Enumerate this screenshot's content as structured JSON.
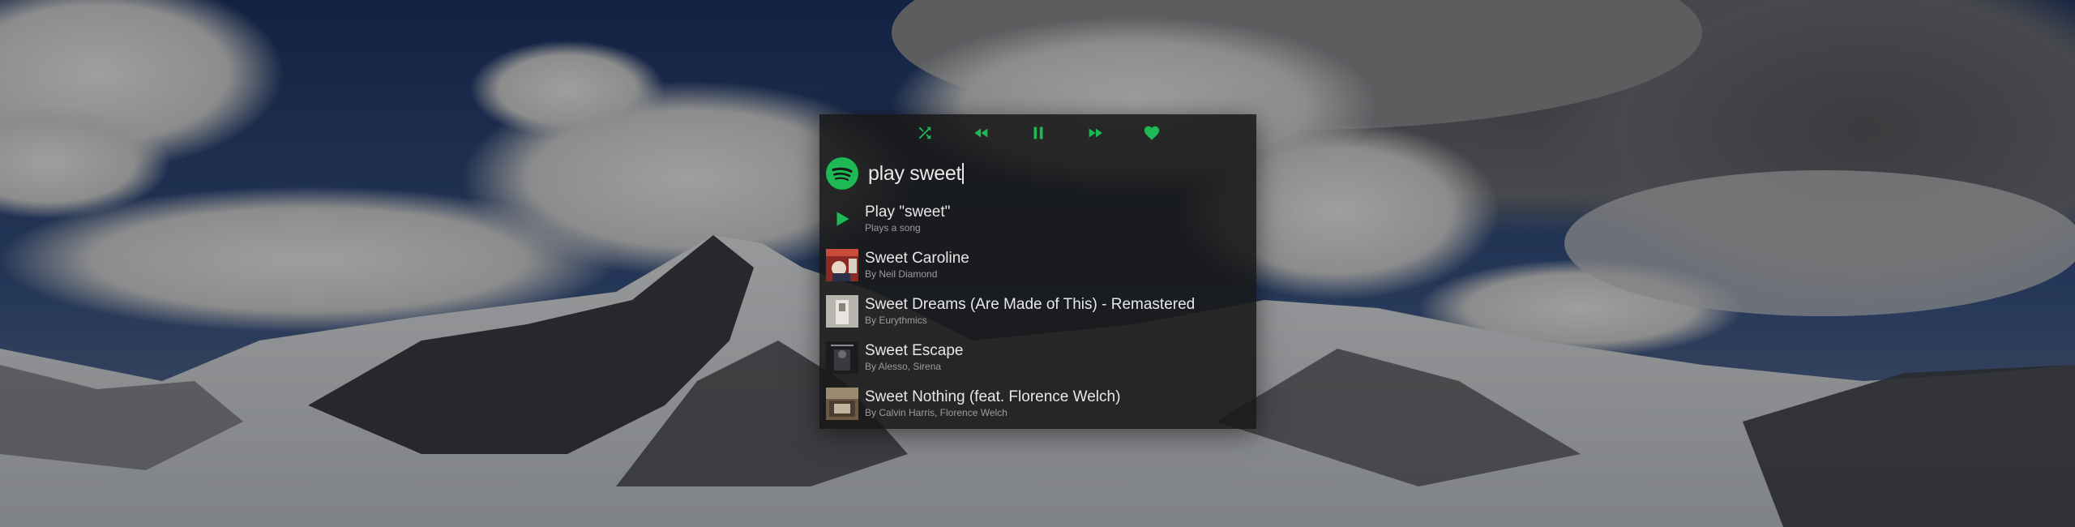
{
  "controls": {
    "shuffle_icon": "shuffle-icon",
    "previous_icon": "previous-icon",
    "pause_icon": "pause-icon",
    "next_icon": "next-icon",
    "like_icon": "heart-icon"
  },
  "search": {
    "app_icon": "spotify-logo",
    "query": "play sweet"
  },
  "results": [
    {
      "title": "Play \"sweet\"",
      "subtitle": "Plays a song",
      "icon": "play-icon"
    },
    {
      "title": "Sweet Caroline",
      "subtitle": "By Neil Diamond"
    },
    {
      "title": "Sweet Dreams (Are Made of This) - Remastered",
      "subtitle": "By Eurythmics"
    },
    {
      "title": "Sweet Escape",
      "subtitle": "By Alesso, Sirena"
    },
    {
      "title": "Sweet Nothing (feat. Florence Welch)",
      "subtitle": "By Calvin Harris, Florence Welch"
    }
  ],
  "colors": {
    "accent": "#1db954",
    "panel": "#181818"
  }
}
